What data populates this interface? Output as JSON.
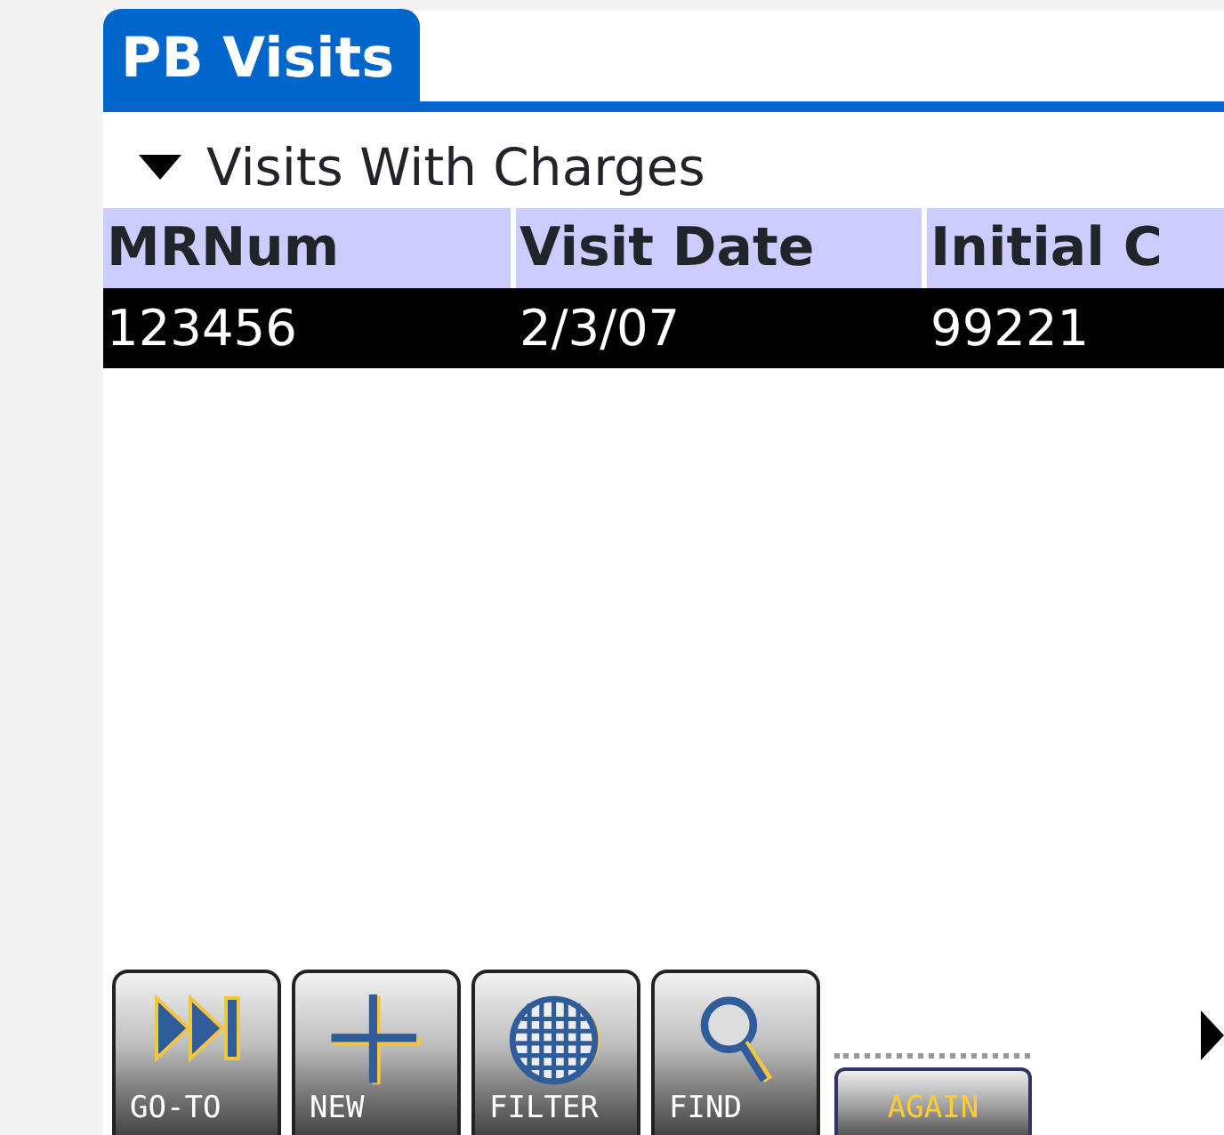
{
  "tab": {
    "title": "PB Visits"
  },
  "category": {
    "label": "Visits With Charges"
  },
  "table": {
    "columns": [
      "MRNum",
      "Visit Date",
      "Initial C"
    ],
    "rows": [
      {
        "cells": [
          "123456",
          "2/3/07",
          "99221"
        ],
        "selected": true
      }
    ]
  },
  "buttons": [
    {
      "label": "GO-TO",
      "kind": "goto"
    },
    {
      "label": "NEW",
      "kind": "new"
    },
    {
      "label": "FILTER",
      "kind": "filter"
    },
    {
      "label": "FIND",
      "kind": "find"
    },
    {
      "label": "AGAIN",
      "kind": "text"
    }
  ]
}
